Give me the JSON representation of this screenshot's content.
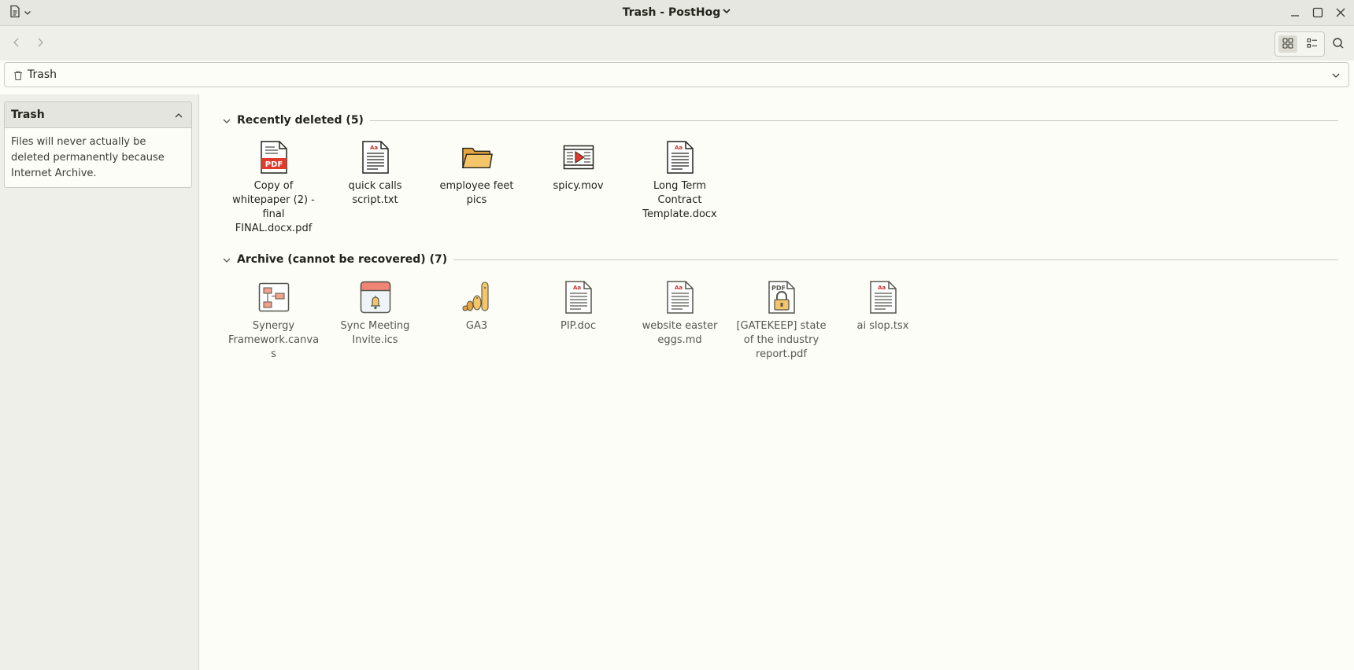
{
  "window": {
    "title": "Trash - PostHog"
  },
  "icons": {
    "doc_menu": "document-icon",
    "minimize": "minimize-icon",
    "maximize": "maximize-icon",
    "close": "close-icon",
    "back": "back-icon",
    "forward": "forward-icon",
    "grid_view": "grid-view-icon",
    "list_view": "list-view-icon",
    "search": "search-icon"
  },
  "address_bar": {
    "icon": "trash-icon",
    "path": "Trash"
  },
  "info_panel": {
    "title": "Trash",
    "text": "Files will never actually be deleted permanently because Internet Archive."
  },
  "sections": [
    {
      "title": "Recently deleted (5)",
      "items": [
        {
          "label": "Copy of whitepaper (2) - final FINAL.docx.pdf",
          "icon": "pdf-file-icon"
        },
        {
          "label": "quick calls script.txt",
          "icon": "text-file-icon"
        },
        {
          "label": "employee feet pics",
          "icon": "folder-icon"
        },
        {
          "label": "spicy.mov",
          "icon": "video-file-icon"
        },
        {
          "label": "Long Term Contract Template.docx",
          "icon": "document-file-icon"
        }
      ]
    },
    {
      "title": "Archive (cannot be recovered) (7)",
      "items": [
        {
          "label": "Synergy Framework.canvas",
          "icon": "canvas-file-icon"
        },
        {
          "label": "Sync Meeting Invite.ics",
          "icon": "calendar-file-icon"
        },
        {
          "label": "GA3",
          "icon": "hedgehog-family-icon"
        },
        {
          "label": "PIP.doc",
          "icon": "document-file-icon"
        },
        {
          "label": "website easter eggs.md",
          "icon": "text-file-icon"
        },
        {
          "label": "[GATEKEEP] state of the industry report.pdf",
          "icon": "locked-pdf-icon"
        },
        {
          "label": "ai slop.tsx",
          "icon": "text-file-icon"
        }
      ]
    }
  ]
}
